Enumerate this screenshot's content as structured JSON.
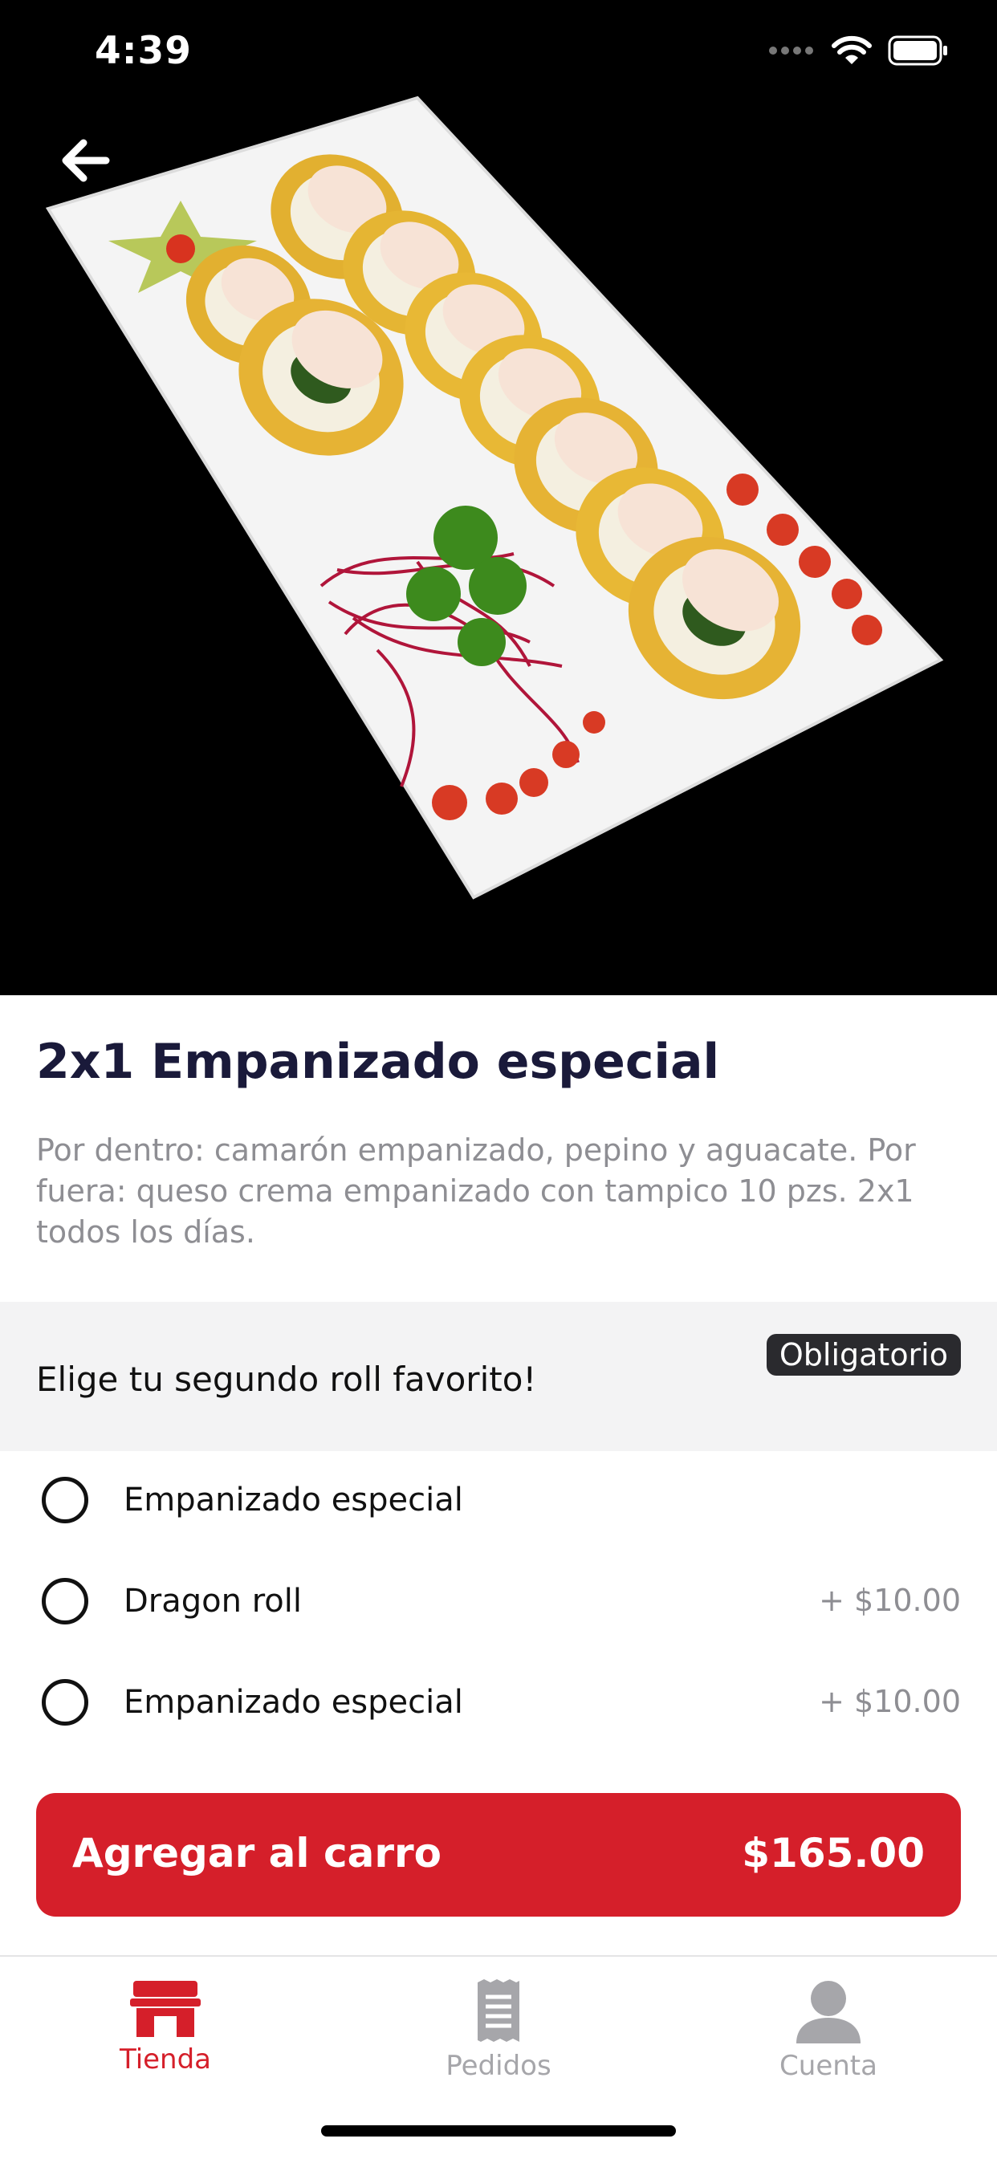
{
  "status_bar": {
    "time": "4:39"
  },
  "product": {
    "title": "2x1 Empanizado especial",
    "description": "Por dentro: camarón empanizado, pepino y aguacate. Por fuera: queso crema empanizado con tampico 10 pzs. 2x1 todos los días."
  },
  "option_group": {
    "title": "Elige tu segundo roll favorito!",
    "badge": "Obligatorio",
    "options": [
      {
        "label": "Empanizado especial",
        "price": ""
      },
      {
        "label": "Dragon roll",
        "price": "+ $10.00"
      },
      {
        "label": "Empanizado especial",
        "price": "+ $10.00"
      }
    ]
  },
  "cta": {
    "label": "Agregar al carro",
    "price": "$165.00"
  },
  "tabbar": {
    "tabs": [
      {
        "label": "Tienda",
        "icon": "store-icon",
        "active": true
      },
      {
        "label": "Pedidos",
        "icon": "receipt-icon",
        "active": false
      },
      {
        "label": "Cuenta",
        "icon": "person-icon",
        "active": false
      }
    ]
  },
  "colors": {
    "accent": "#d51f2a",
    "title": "#1a1a3a",
    "muted": "#8e8e93",
    "badge_bg": "#2a2a2e",
    "group_bg": "#f3f3f4"
  }
}
